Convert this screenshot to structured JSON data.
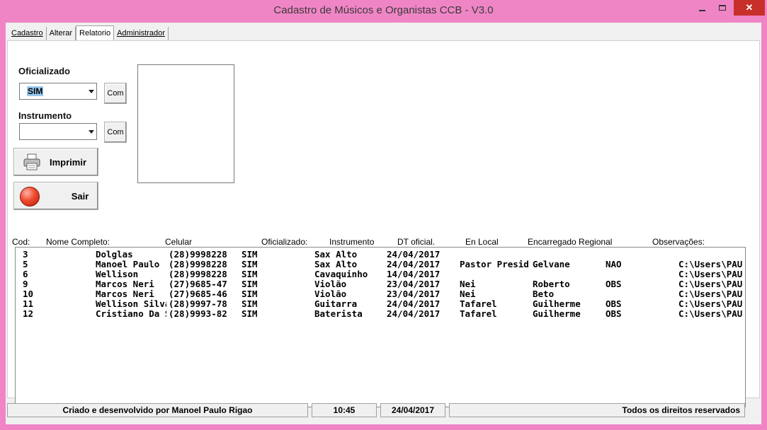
{
  "window": {
    "title": "Cadastro de Músicos e Organistas CCB - V3.0",
    "minimize_icon": "minimize-icon",
    "maximize_icon": "maximize-icon",
    "close_glyph": "✕"
  },
  "tabs": [
    {
      "label": "Cadastro"
    },
    {
      "label": "Alterar"
    },
    {
      "label": "Relatorio"
    },
    {
      "label": "Administrador"
    }
  ],
  "filters": {
    "oficializado_label": "Oficializado",
    "oficializado_value": "SIM",
    "instrumento_label": "Instrumento",
    "instrumento_value": "",
    "com_label_1": "Com",
    "com_label_2": "Com"
  },
  "actions": {
    "print_label": "Imprimir",
    "print_icon": "printer-icon",
    "exit_label": "Sair",
    "exit_icon": "red-circle-icon"
  },
  "table": {
    "columns": [
      "Cod:",
      "Nome Completo:",
      "Celular",
      "Oficializado:",
      "Instrumento",
      "DT oficial.",
      "En Local",
      "Encarregado Regional",
      "Observações:"
    ],
    "rows": [
      {
        "cod": "3",
        "nome": "Dolglas",
        "celular": "(28)9998228",
        "ofic": "SIM",
        "instr": "Sax Alto",
        "dt": "24/04/2017",
        "local": "",
        "regional": "",
        "obs": "",
        "path": ""
      },
      {
        "cod": "5",
        "nome": "Manoel Paulo",
        "celular": "(28)9998228",
        "ofic": "SIM",
        "instr": "Sax Alto",
        "dt": "24/04/2017",
        "local": "Pastor Preside",
        "regional": "Gelvane",
        "obs": "NAO",
        "path": "C:\\Users\\PAU"
      },
      {
        "cod": "6",
        "nome": "Wellison",
        "celular": "(28)9998228",
        "ofic": "SIM",
        "instr": "Cavaquinho",
        "dt": "14/04/2017",
        "local": "",
        "regional": "",
        "obs": "",
        "path": "C:\\Users\\PAU"
      },
      {
        "cod": "9",
        "nome": "Marcos Neri",
        "celular": "(27)9685-47",
        "ofic": "SIM",
        "instr": "Violão",
        "dt": "23/04/2017",
        "local": "Nei",
        "regional": "Roberto",
        "obs": "OBS",
        "path": "C:\\Users\\PAU"
      },
      {
        "cod": "10",
        "nome": "Marcos Neri",
        "celular": "(27)9685-46",
        "ofic": "SIM",
        "instr": "Violão",
        "dt": "23/04/2017",
        "local": "Nei",
        "regional": "Beto",
        "obs": "",
        "path": "C:\\Users\\PAU"
      },
      {
        "cod": "11",
        "nome": "Wellison Silva",
        "celular": "(28)9997-78",
        "ofic": "SIM",
        "instr": "Guitarra",
        "dt": "24/04/2017",
        "local": "Tafarel",
        "regional": "Guilherme",
        "obs": "OBS",
        "path": "C:\\Users\\PAU"
      },
      {
        "cod": "12",
        "nome": "Cristiano Da S",
        "celular": "(28)9993-82",
        "ofic": "SIM",
        "instr": "Baterista",
        "dt": "24/04/2017",
        "local": "Tafarel",
        "regional": "Guilherme",
        "obs": "OBS",
        "path": "C:\\Users\\PAU"
      }
    ]
  },
  "status": {
    "credits": "Criado e desenvolvido por Manoel Paulo Rigao",
    "time": "10:45",
    "date": "24/04/2017",
    "rights": "Todos os direitos reservados"
  },
  "colors": {
    "window_frame": "#f085c6",
    "close_button": "#c7302a",
    "selection": "#99c9ef"
  }
}
